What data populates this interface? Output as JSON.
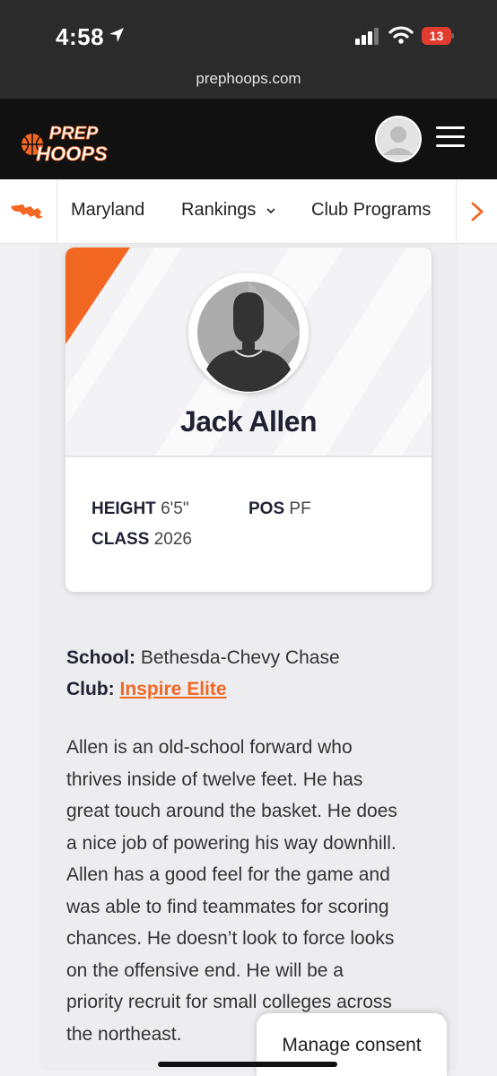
{
  "status_bar": {
    "time": "4:58",
    "battery": "13"
  },
  "browser": {
    "url": "prephoops.com"
  },
  "header": {
    "logo_line1": "PREP",
    "logo_line2": "HOOPS"
  },
  "nav": {
    "items": [
      {
        "label": "Maryland"
      },
      {
        "label": "Rankings"
      },
      {
        "label": "Club Programs"
      }
    ]
  },
  "player": {
    "name": "Jack Allen",
    "height_label": "HEIGHT",
    "height_value": "6'5\"",
    "pos_label": "POS",
    "pos_value": "PF",
    "class_label": "CLASS",
    "class_value": "2026"
  },
  "details": {
    "school_label": "School:",
    "school_value": "Bethesda-Chevy Chase",
    "club_label": "Club:",
    "club_value": "Inspire Elite"
  },
  "bio_lines": [
    "Allen is an old-school forward who",
    "thrives inside of twelve feet. He has",
    "great touch around the basket. He does",
    "a nice job of powering his way downhill.",
    "Allen has a good feel for the game and",
    "was able to find teammates for scoring",
    "chances. He doesn’t look to force looks",
    "on the offensive end. He will be a",
    "priority recruit for small colleges across",
    "the northeast."
  ],
  "consent": {
    "label": "Manage consent"
  },
  "colors": {
    "accent": "#f26722",
    "header_bg": "#111111",
    "status_bg": "#2b2b2b"
  }
}
